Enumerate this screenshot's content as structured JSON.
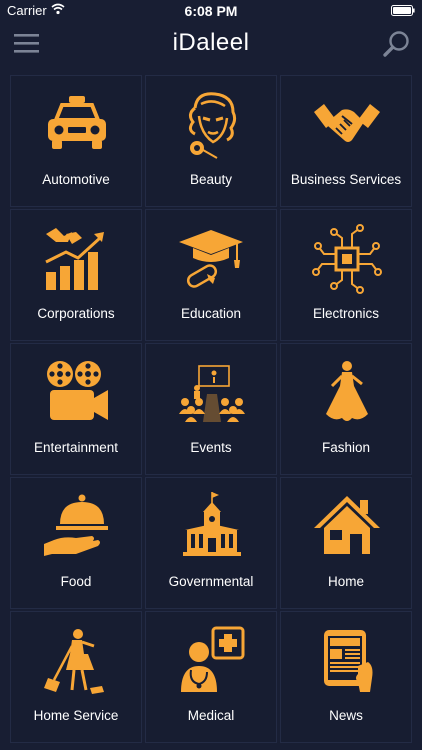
{
  "status_bar": {
    "carrier": "Carrier",
    "time": "6:08 PM"
  },
  "app": {
    "title": "iDaleel"
  },
  "colors": {
    "background": "#181e33",
    "tile": "#171d31",
    "accent": "#f7a636",
    "nav_icon": "#7c8496"
  },
  "categories": [
    {
      "label": "Automotive",
      "icon": "taxi-icon"
    },
    {
      "label": "Beauty",
      "icon": "woman-face-icon"
    },
    {
      "label": "Business Services",
      "icon": "handshake-icon"
    },
    {
      "label": "Corporations",
      "icon": "growth-chart-icon"
    },
    {
      "label": "Education",
      "icon": "graduation-cap-icon"
    },
    {
      "label": "Electronics",
      "icon": "circuit-chip-icon"
    },
    {
      "label": "Entertainment",
      "icon": "movie-camera-icon"
    },
    {
      "label": "Events",
      "icon": "audience-icon"
    },
    {
      "label": "Fashion",
      "icon": "dress-woman-icon"
    },
    {
      "label": "Food",
      "icon": "cloche-icon"
    },
    {
      "label": "Governmental",
      "icon": "government-building-icon"
    },
    {
      "label": "Home",
      "icon": "house-icon"
    },
    {
      "label": "Home Service",
      "icon": "cleaning-lady-icon"
    },
    {
      "label": "Medical",
      "icon": "doctor-icon"
    },
    {
      "label": "News",
      "icon": "newspaper-icon"
    }
  ]
}
